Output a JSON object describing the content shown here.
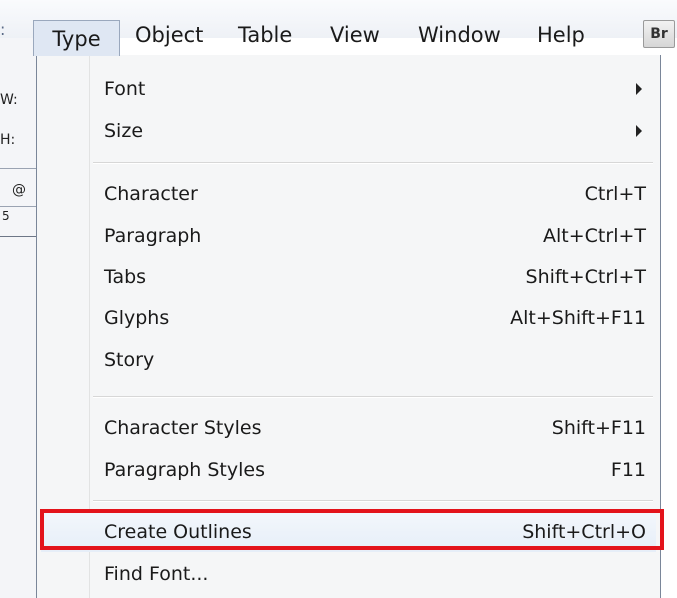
{
  "menubar": {
    "items": [
      {
        "label": "Type",
        "active": true
      },
      {
        "label": "Object",
        "active": false
      },
      {
        "label": "Table",
        "active": false
      },
      {
        "label": "View",
        "active": false
      },
      {
        "label": "Window",
        "active": false
      },
      {
        "label": "Help",
        "active": false
      }
    ],
    "bridge_badge": "Br"
  },
  "app_strip": {
    "width_label": "W:",
    "height_label": "H:",
    "at_label": "@",
    "ruler_value": "5"
  },
  "type_menu": {
    "groups": [
      [
        {
          "label": "Font",
          "shortcut": "",
          "submenu": true
        },
        {
          "label": "Size",
          "shortcut": "",
          "submenu": true
        }
      ],
      [
        {
          "label": "Character",
          "shortcut": "Ctrl+T",
          "submenu": false
        },
        {
          "label": "Paragraph",
          "shortcut": "Alt+Ctrl+T",
          "submenu": false
        },
        {
          "label": "Tabs",
          "shortcut": "Shift+Ctrl+T",
          "submenu": false
        },
        {
          "label": "Glyphs",
          "shortcut": "Alt+Shift+F11",
          "submenu": false
        },
        {
          "label": "Story",
          "shortcut": "",
          "submenu": false
        }
      ],
      [
        {
          "label": "Character Styles",
          "shortcut": "Shift+F11",
          "submenu": false
        },
        {
          "label": "Paragraph Styles",
          "shortcut": "F11",
          "submenu": false
        }
      ],
      [
        {
          "label": "Create Outlines",
          "shortcut": "Shift+Ctrl+O",
          "submenu": false,
          "highlighted": true
        },
        {
          "label": "Find Font...",
          "shortcut": "",
          "submenu": false
        }
      ]
    ]
  },
  "colors": {
    "highlight_border": "#e3131b",
    "menu_background": "#f5f6f7",
    "active_menubar_item": "#dfe7f3"
  }
}
